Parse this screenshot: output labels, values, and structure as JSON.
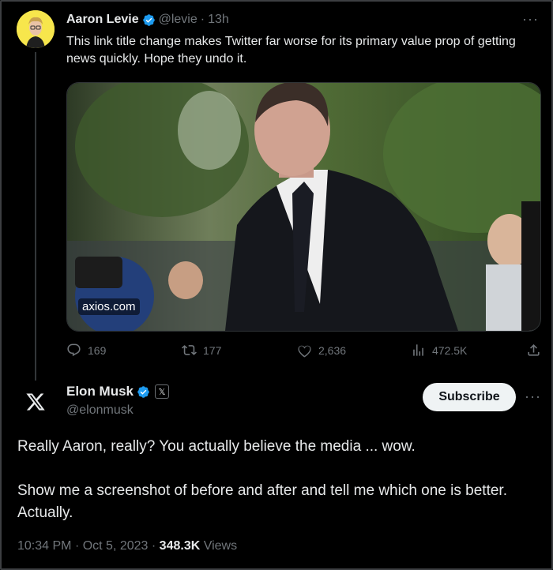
{
  "colors": {
    "background": "#000000",
    "text": "#e7e9ea",
    "muted": "#71767b",
    "verified": "#1d9bf0",
    "avatar_bg": "#f7e64c"
  },
  "tweet1": {
    "name": "Aaron Levie",
    "handle": "@levie",
    "separator": "·",
    "time": "13h",
    "more": "···",
    "text": "This link title change makes Twitter far worse for its primary value prop of getting news quickly. Hope they undo it.",
    "card": {
      "domain": "axios.com"
    },
    "actions": {
      "replies": "169",
      "retweets": "177",
      "likes": "2,636",
      "views": "472.5K"
    },
    "icons": [
      "reply-icon",
      "retweet-icon",
      "like-icon",
      "views-icon",
      "share-icon"
    ]
  },
  "tweet2": {
    "name": "Elon Musk",
    "affiliate_badge": "𝕏",
    "handle": "@elonmusk",
    "subscribe_label": "Subscribe",
    "more": "···",
    "text_line1": "Really Aaron, really? You actually believe the media ... wow.",
    "text_line2": "Show me a screenshot of before and after and tell me which one is better. Actually.",
    "time": "10:34 PM",
    "sep1": "·",
    "date": "Oct 5, 2023",
    "sep2": "·",
    "views_count": "348.3K",
    "views_label": "Views"
  }
}
